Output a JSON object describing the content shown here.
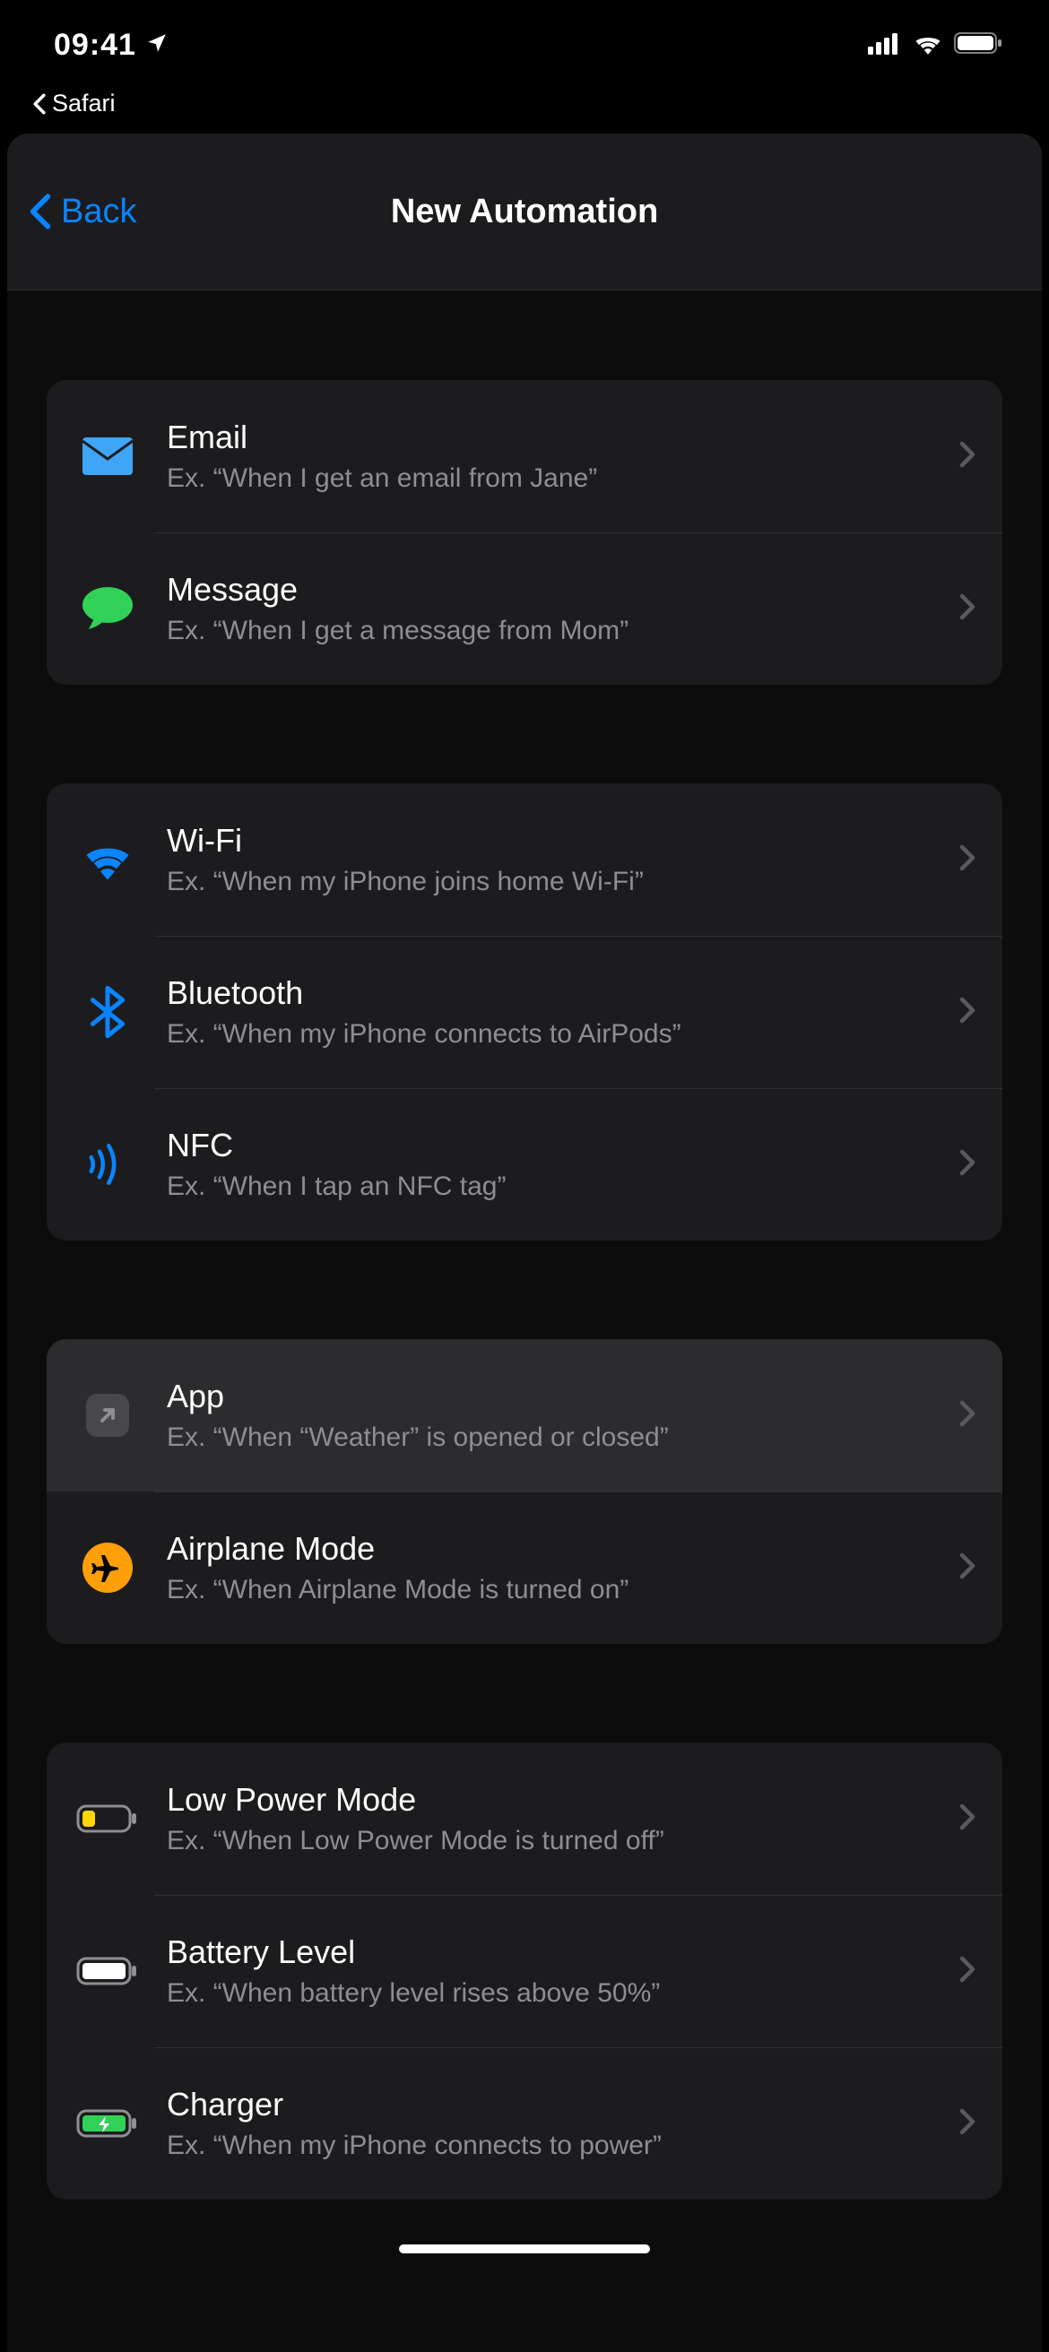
{
  "status": {
    "time": "09:41",
    "breadcrumb": "Safari"
  },
  "nav": {
    "back": "Back",
    "title": "New Automation"
  },
  "groups": [
    {
      "rows": [
        {
          "icon": "email",
          "title": "Email",
          "subtitle": "Ex. “When I get an email from Jane”"
        },
        {
          "icon": "message",
          "title": "Message",
          "subtitle": "Ex. “When I get a message from Mom”"
        }
      ]
    },
    {
      "rows": [
        {
          "icon": "wifi",
          "title": "Wi-Fi",
          "subtitle": "Ex. “When my iPhone joins home Wi-Fi”"
        },
        {
          "icon": "bluetooth",
          "title": "Bluetooth",
          "subtitle": "Ex. “When my iPhone connects to AirPods”"
        },
        {
          "icon": "nfc",
          "title": "NFC",
          "subtitle": "Ex. “When I tap an NFC tag”"
        }
      ]
    },
    {
      "rows": [
        {
          "icon": "app",
          "title": "App",
          "subtitle": "Ex. “When “Weather” is opened or closed”",
          "highlighted": true
        },
        {
          "icon": "airplane",
          "title": "Airplane Mode",
          "subtitle": "Ex. “When Airplane Mode is turned on”"
        }
      ]
    },
    {
      "rows": [
        {
          "icon": "lowpower",
          "title": "Low Power Mode",
          "subtitle": "Ex. “When Low Power Mode is turned off”"
        },
        {
          "icon": "battery",
          "title": "Battery Level",
          "subtitle": "Ex. “When battery level rises above 50%”"
        },
        {
          "icon": "charger",
          "title": "Charger",
          "subtitle": "Ex. “When my iPhone connects to power”"
        }
      ]
    }
  ]
}
